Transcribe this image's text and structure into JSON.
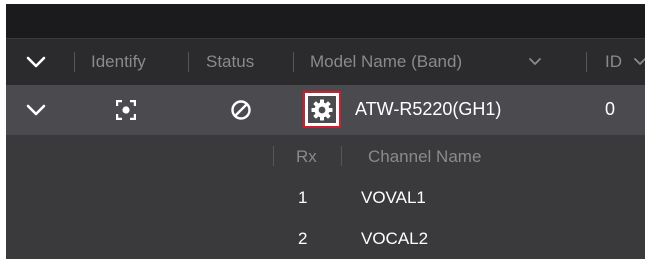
{
  "header": {
    "identify_label": "Identify",
    "status_label": "Status",
    "model_name_label": "Model Name (Band)",
    "id_label": "ID"
  },
  "device": {
    "model_name": "ATW-R5220(GH1)",
    "id": "0"
  },
  "channels": {
    "rx_label": "Rx",
    "channel_name_label": "Channel Name",
    "rows": [
      {
        "rx": "1",
        "name": "VOVAL1"
      },
      {
        "rx": "2",
        "name": "VOCAL2"
      }
    ]
  },
  "colors": {
    "highlight_border": "#d01c2c",
    "row_background": "#4b4b4f",
    "header_text": "#8a8a8e"
  }
}
